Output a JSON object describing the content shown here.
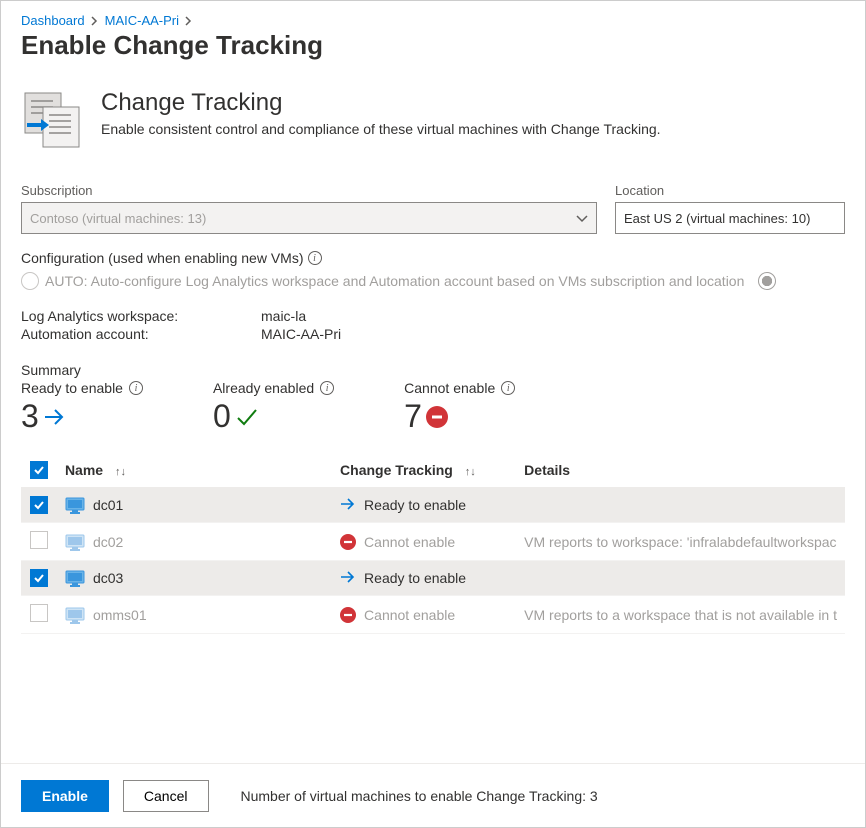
{
  "breadcrumb": {
    "items": [
      "Dashboard",
      "MAIC-AA-Pri"
    ]
  },
  "page_title": "Enable Change Tracking",
  "hero": {
    "title": "Change Tracking",
    "subtitle": "Enable consistent control and compliance of these virtual machines with Change Tracking."
  },
  "subscription": {
    "label": "Subscription",
    "value": "Contoso  (virtual machines: 13)"
  },
  "location": {
    "label": "Location",
    "value": "East US 2 (virtual machines: 10)"
  },
  "config": {
    "label": "Configuration (used when enabling new VMs)",
    "auto_label": "AUTO: Auto-configure Log Analytics workspace and Automation account based on VMs subscription and location"
  },
  "kv": {
    "law_label": "Log Analytics workspace:",
    "law_value": "maic-la",
    "aa_label": "Automation account:",
    "aa_value": "MAIC-AA-Pri"
  },
  "summary": {
    "label": "Summary",
    "ready": {
      "label": "Ready to enable",
      "value": "3"
    },
    "already": {
      "label": "Already enabled",
      "value": "0"
    },
    "cannot": {
      "label": "Cannot enable",
      "value": "7"
    }
  },
  "table": {
    "headers": {
      "name": "Name",
      "ct": "Change Tracking",
      "details": "Details"
    },
    "rows": [
      {
        "checked": true,
        "enabled": true,
        "name": "dc01",
        "status": "ready",
        "status_text": "Ready to enable",
        "details": ""
      },
      {
        "checked": false,
        "enabled": false,
        "name": "dc02",
        "status": "cannot",
        "status_text": "Cannot enable",
        "details": "VM reports to workspace: 'infralabdefaultworkspac"
      },
      {
        "checked": true,
        "enabled": true,
        "name": "dc03",
        "status": "ready",
        "status_text": "Ready to enable",
        "details": ""
      },
      {
        "checked": false,
        "enabled": false,
        "name": "omms01",
        "status": "cannot",
        "status_text": "Cannot enable",
        "details": "VM reports to a workspace that is not available in t"
      }
    ]
  },
  "footer": {
    "enable": "Enable",
    "cancel": "Cancel",
    "count_text": "Number of virtual machines to enable Change Tracking: 3"
  }
}
